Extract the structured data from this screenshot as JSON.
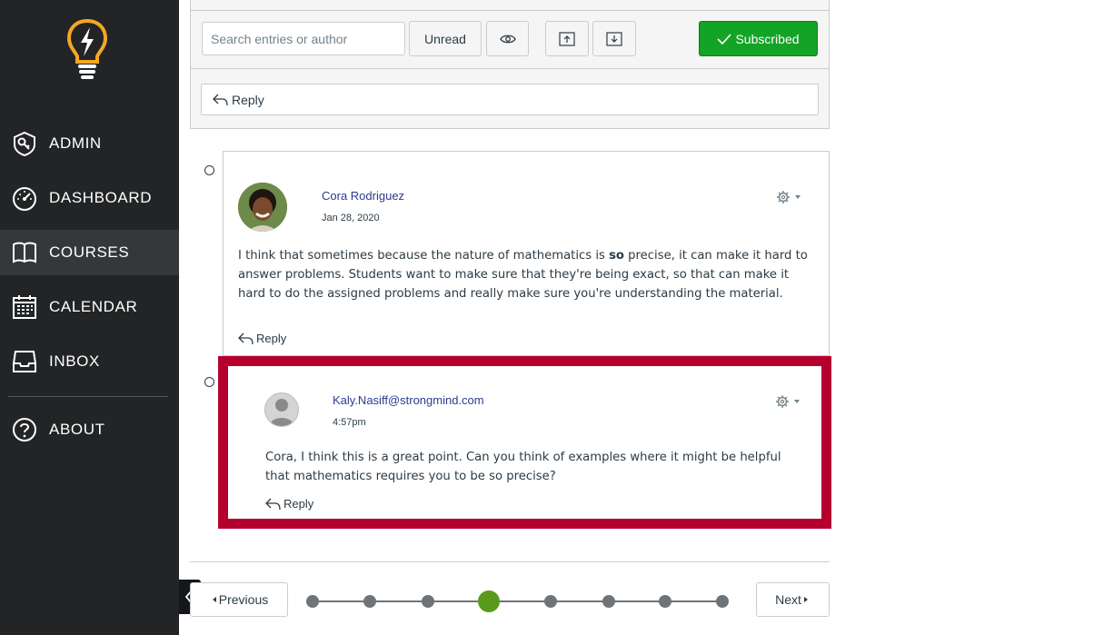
{
  "sidebar": {
    "items": [
      {
        "label": "ADMIN",
        "icon": "shield-icon"
      },
      {
        "label": "DASHBOARD",
        "icon": "speedometer-icon"
      },
      {
        "label": "COURSES",
        "icon": "book-icon",
        "active": true
      },
      {
        "label": "CALENDAR",
        "icon": "calendar-icon"
      },
      {
        "label": "INBOX",
        "icon": "inbox-icon"
      },
      {
        "label": "ABOUT",
        "icon": "question-icon"
      }
    ]
  },
  "toolbar": {
    "search_placeholder": "Search entries or author",
    "unread_label": "Unread",
    "subscribed_label": "Subscribed",
    "reply_label": "Reply"
  },
  "entries": [
    {
      "author": "Cora Rodriguez",
      "date": "Jan 28, 2020",
      "message_pre": "I think that sometimes because the nature of mathematics is ",
      "message_bold": "so",
      "message_post": " precise, it can make it hard to answer problems. Students want to make sure that they're being exact, so that can make it hard to do the assigned problems and really make sure you're understanding the material.",
      "reply_label": "Reply"
    },
    {
      "author": "Kaly.Nasiff@strongmind.com",
      "date": "4:57pm",
      "message": "Cora, I think this is a great point. Can you think of examples where it might be helpful that mathematics requires you to be so precise?",
      "reply_label": "Reply"
    }
  ],
  "pagination": {
    "previous_label": "Previous",
    "next_label": "Next",
    "total_steps": 8,
    "current_step": 4
  },
  "colors": {
    "sidebar_bg": "#222426",
    "subscribed_green": "#13a325",
    "highlight_red": "#b5002f",
    "link_blue": "#2d3b8e",
    "current_step_green": "#5a9a1a"
  }
}
